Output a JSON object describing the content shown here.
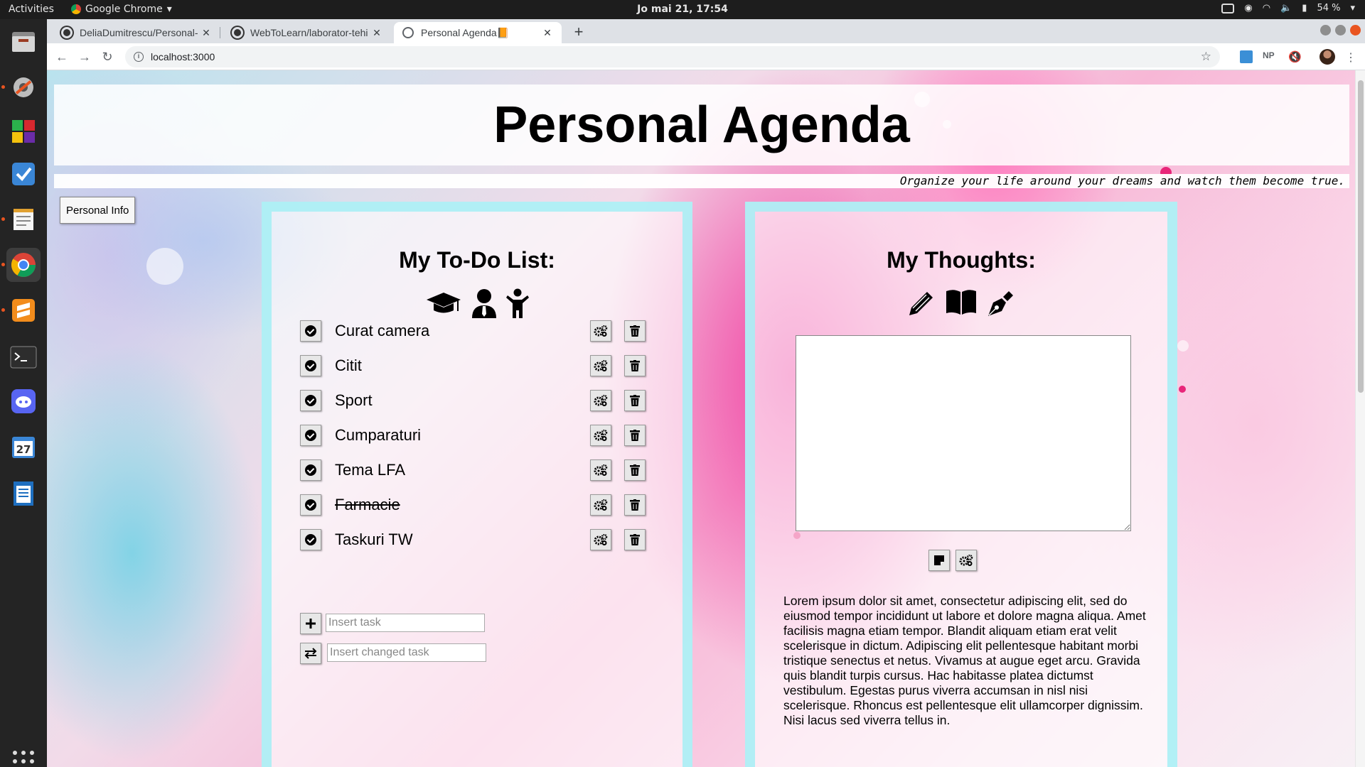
{
  "os": {
    "activities": "Activities",
    "app_name": "Google Chrome",
    "clock": "Jo mai 21, 17:54",
    "battery": "54 %",
    "calendar_day": "27"
  },
  "browser": {
    "tabs": [
      {
        "title": "DeliaDumitrescu/Personal-",
        "favicon": "github-icon"
      },
      {
        "title": "WebToLearn/laborator-tehi",
        "favicon": "github-icon"
      },
      {
        "title": "Personal Agenda📙",
        "favicon": "globe-icon",
        "active": true
      }
    ],
    "url": "localhost:3000",
    "ext_np": "NP"
  },
  "page": {
    "title": "Personal Agenda",
    "motto": "Organize your life around your dreams and watch them become true.",
    "personal_info_button": "Personal Info",
    "todo": {
      "heading": "My To-Do List:",
      "icons": [
        "graduation-cap-icon",
        "user-tie-icon",
        "child-icon"
      ],
      "tasks": [
        {
          "text": "Curat camera",
          "done": false
        },
        {
          "text": "Citit",
          "done": false
        },
        {
          "text": "Sport",
          "done": false
        },
        {
          "text": "Cumparaturi",
          "done": false
        },
        {
          "text": "Tema LFA",
          "done": false
        },
        {
          "text": "Farmacie",
          "done": true
        },
        {
          "text": "Taskuri TW",
          "done": false
        }
      ],
      "insert_placeholder": "Insert task",
      "change_placeholder": "Insert changed task"
    },
    "thoughts": {
      "heading": "My Thoughts:",
      "icons": [
        "pencil-icon",
        "book-open-icon",
        "pen-nib-icon"
      ],
      "textarea_value": "",
      "lorem": "Lorem ipsum dolor sit amet, consectetur adipiscing elit, sed do eiusmod tempor incididunt ut labore et dolore magna aliqua. Amet facilisis magna etiam tempor. Blandit aliquam etiam erat velit scelerisque in dictum. Adipiscing elit pellentesque habitant morbi tristique senectus et netus. Vivamus at augue eget arcu. Gravida quis blandit turpis cursus. Hac habitasse platea dictumst vestibulum. Egestas purus viverra accumsan in nisl nisi scelerisque. Rhoncus est pellentesque elit ullamcorper dignissim. Nisi lacus sed viverra tellus in."
    }
  },
  "colors": {
    "card_border": "#a5eef5",
    "ubuntu_accent": "#e95420"
  }
}
